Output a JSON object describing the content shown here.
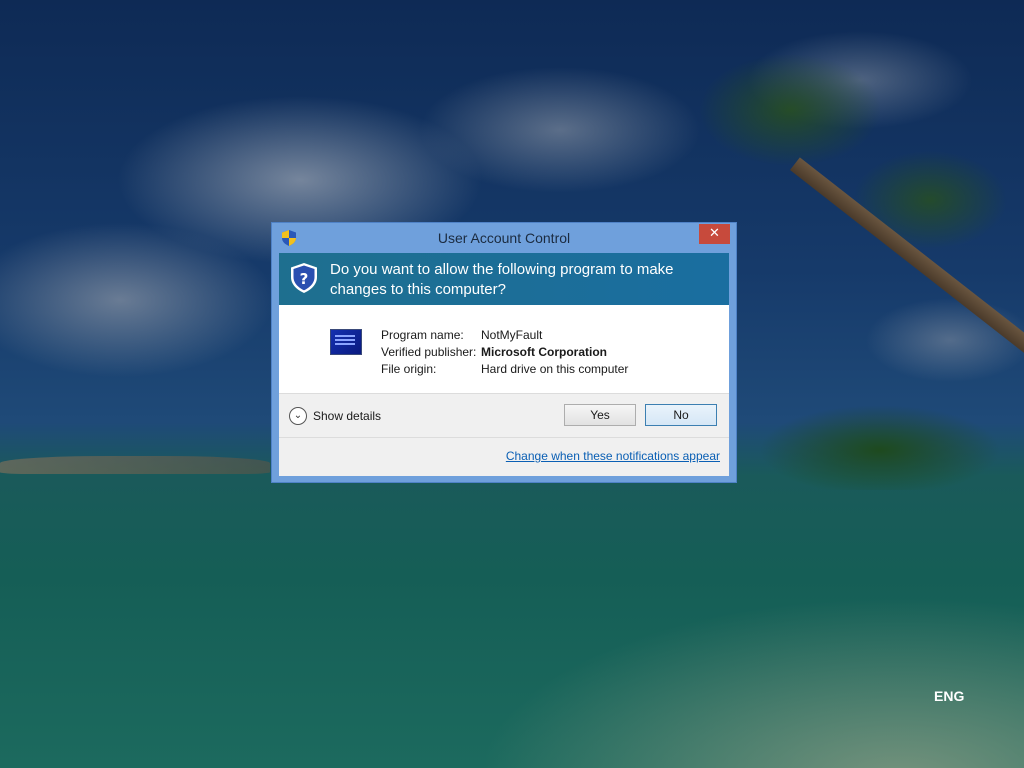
{
  "desktop": {
    "language_indicator": "ENG"
  },
  "dialog": {
    "title": "User Account Control",
    "close_symbol": "✕",
    "question": "Do you want to allow the following program to make changes to this computer?",
    "program_name_label": "Program name:",
    "program_name_value": "NotMyFault",
    "publisher_label": "Verified publisher:",
    "publisher_value": "Microsoft Corporation",
    "origin_label": "File origin:",
    "origin_value": "Hard drive on this computer",
    "show_details_label": "Show details",
    "yes_label": "Yes",
    "no_label": "No",
    "notifications_link": "Change when these notifications appear",
    "icons": {
      "title": "uac-shield-icon",
      "header": "shield-question-icon",
      "program": "program-icon",
      "details": "chevron-down-icon"
    },
    "colors": {
      "frame": "#6fa0dc",
      "header": "#1e6f8f",
      "close": "#c74a3c",
      "link": "#0a5fb4"
    }
  }
}
